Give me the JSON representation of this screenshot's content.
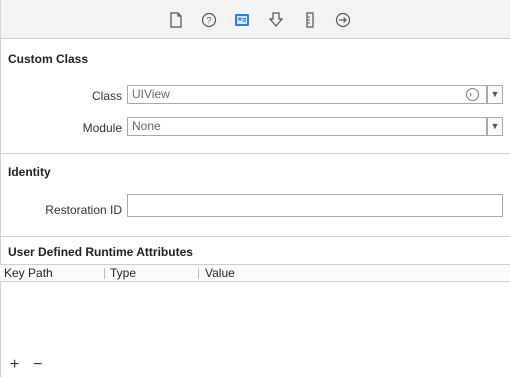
{
  "toolbar": {
    "icons": [
      "file-icon",
      "help-icon",
      "identity-icon",
      "attributes-icon",
      "size-icon",
      "connections-icon"
    ],
    "selected": "identity-icon",
    "accent": "#2f7ed8"
  },
  "custom_class": {
    "header": "Custom Class",
    "class_label": "Class",
    "class_value": "UIView",
    "module_label": "Module",
    "module_value": "None"
  },
  "identity": {
    "header": "Identity",
    "restoration_label": "Restoration ID",
    "restoration_value": ""
  },
  "runtime_attributes": {
    "header": "User Defined Runtime Attributes",
    "columns": [
      "Key Path",
      "Type",
      "Value"
    ],
    "rows": []
  },
  "footer": {
    "add_label": "+",
    "remove_label": "−"
  }
}
